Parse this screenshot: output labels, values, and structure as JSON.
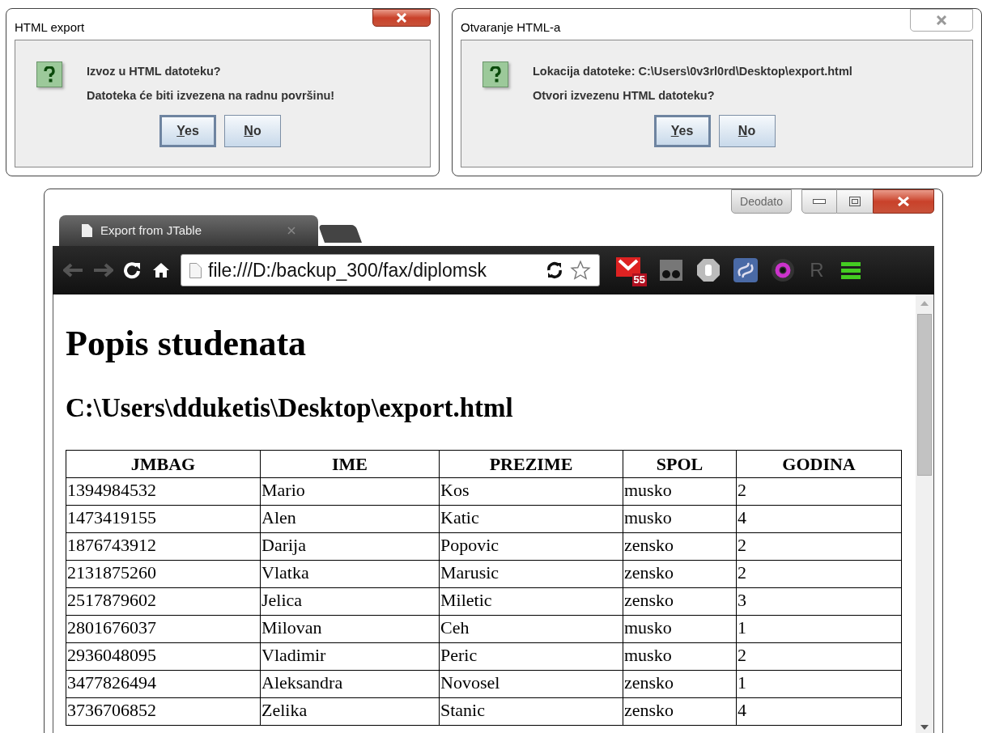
{
  "dialogs": [
    {
      "title": "HTML export",
      "active": true,
      "lines": [
        "Izvoz u HTML datoteku?",
        "Datoteka će biti izvezena na radnu površinu!"
      ],
      "buttons": [
        {
          "label": "Yes",
          "default": true
        },
        {
          "label": "No",
          "default": false
        }
      ]
    },
    {
      "title": "Otvaranje HTML-a",
      "active": false,
      "lines": [
        "Lokacija datoteke: C:\\Users\\0v3rl0rd\\Desktop\\export.html",
        "Otvori izvezenu HTML datoteku?"
      ],
      "buttons": [
        {
          "label": "Yes",
          "default": true
        },
        {
          "label": "No",
          "default": false
        }
      ]
    }
  ],
  "browser": {
    "profile": "Deodato",
    "tab": {
      "title": "Export from JTable"
    },
    "url": "file:///D:/backup_300/fax/diplomsk",
    "mail_badge": "55",
    "extension_letter": "R",
    "page": {
      "heading": "Popis studenata",
      "subheading": "C:\\Users\\dduketis\\Desktop\\export.html",
      "table": {
        "columns": [
          "JMBAG",
          "IME",
          "PREZIME",
          "SPOL",
          "GODINA"
        ],
        "rows": [
          [
            "1394984532",
            "Mario",
            "Kos",
            "musko",
            "2"
          ],
          [
            "1473419155",
            "Alen",
            "Katic",
            "musko",
            "4"
          ],
          [
            "1876743912",
            "Darija",
            "Popovic",
            "zensko",
            "2"
          ],
          [
            "2131875260",
            "Vlatka",
            "Marusic",
            "zensko",
            "2"
          ],
          [
            "2517879602",
            "Jelica",
            "Miletic",
            "zensko",
            "3"
          ],
          [
            "2801676037",
            "Milovan",
            "Ceh",
            "musko",
            "1"
          ],
          [
            "2936048095",
            "Vladimir",
            "Peric",
            "musko",
            "2"
          ],
          [
            "3477826494",
            "Aleksandra",
            "Novosel",
            "zensko",
            "1"
          ],
          [
            "3736706852",
            "Zelika",
            "Stanic",
            "zensko",
            "4"
          ]
        ]
      }
    }
  }
}
